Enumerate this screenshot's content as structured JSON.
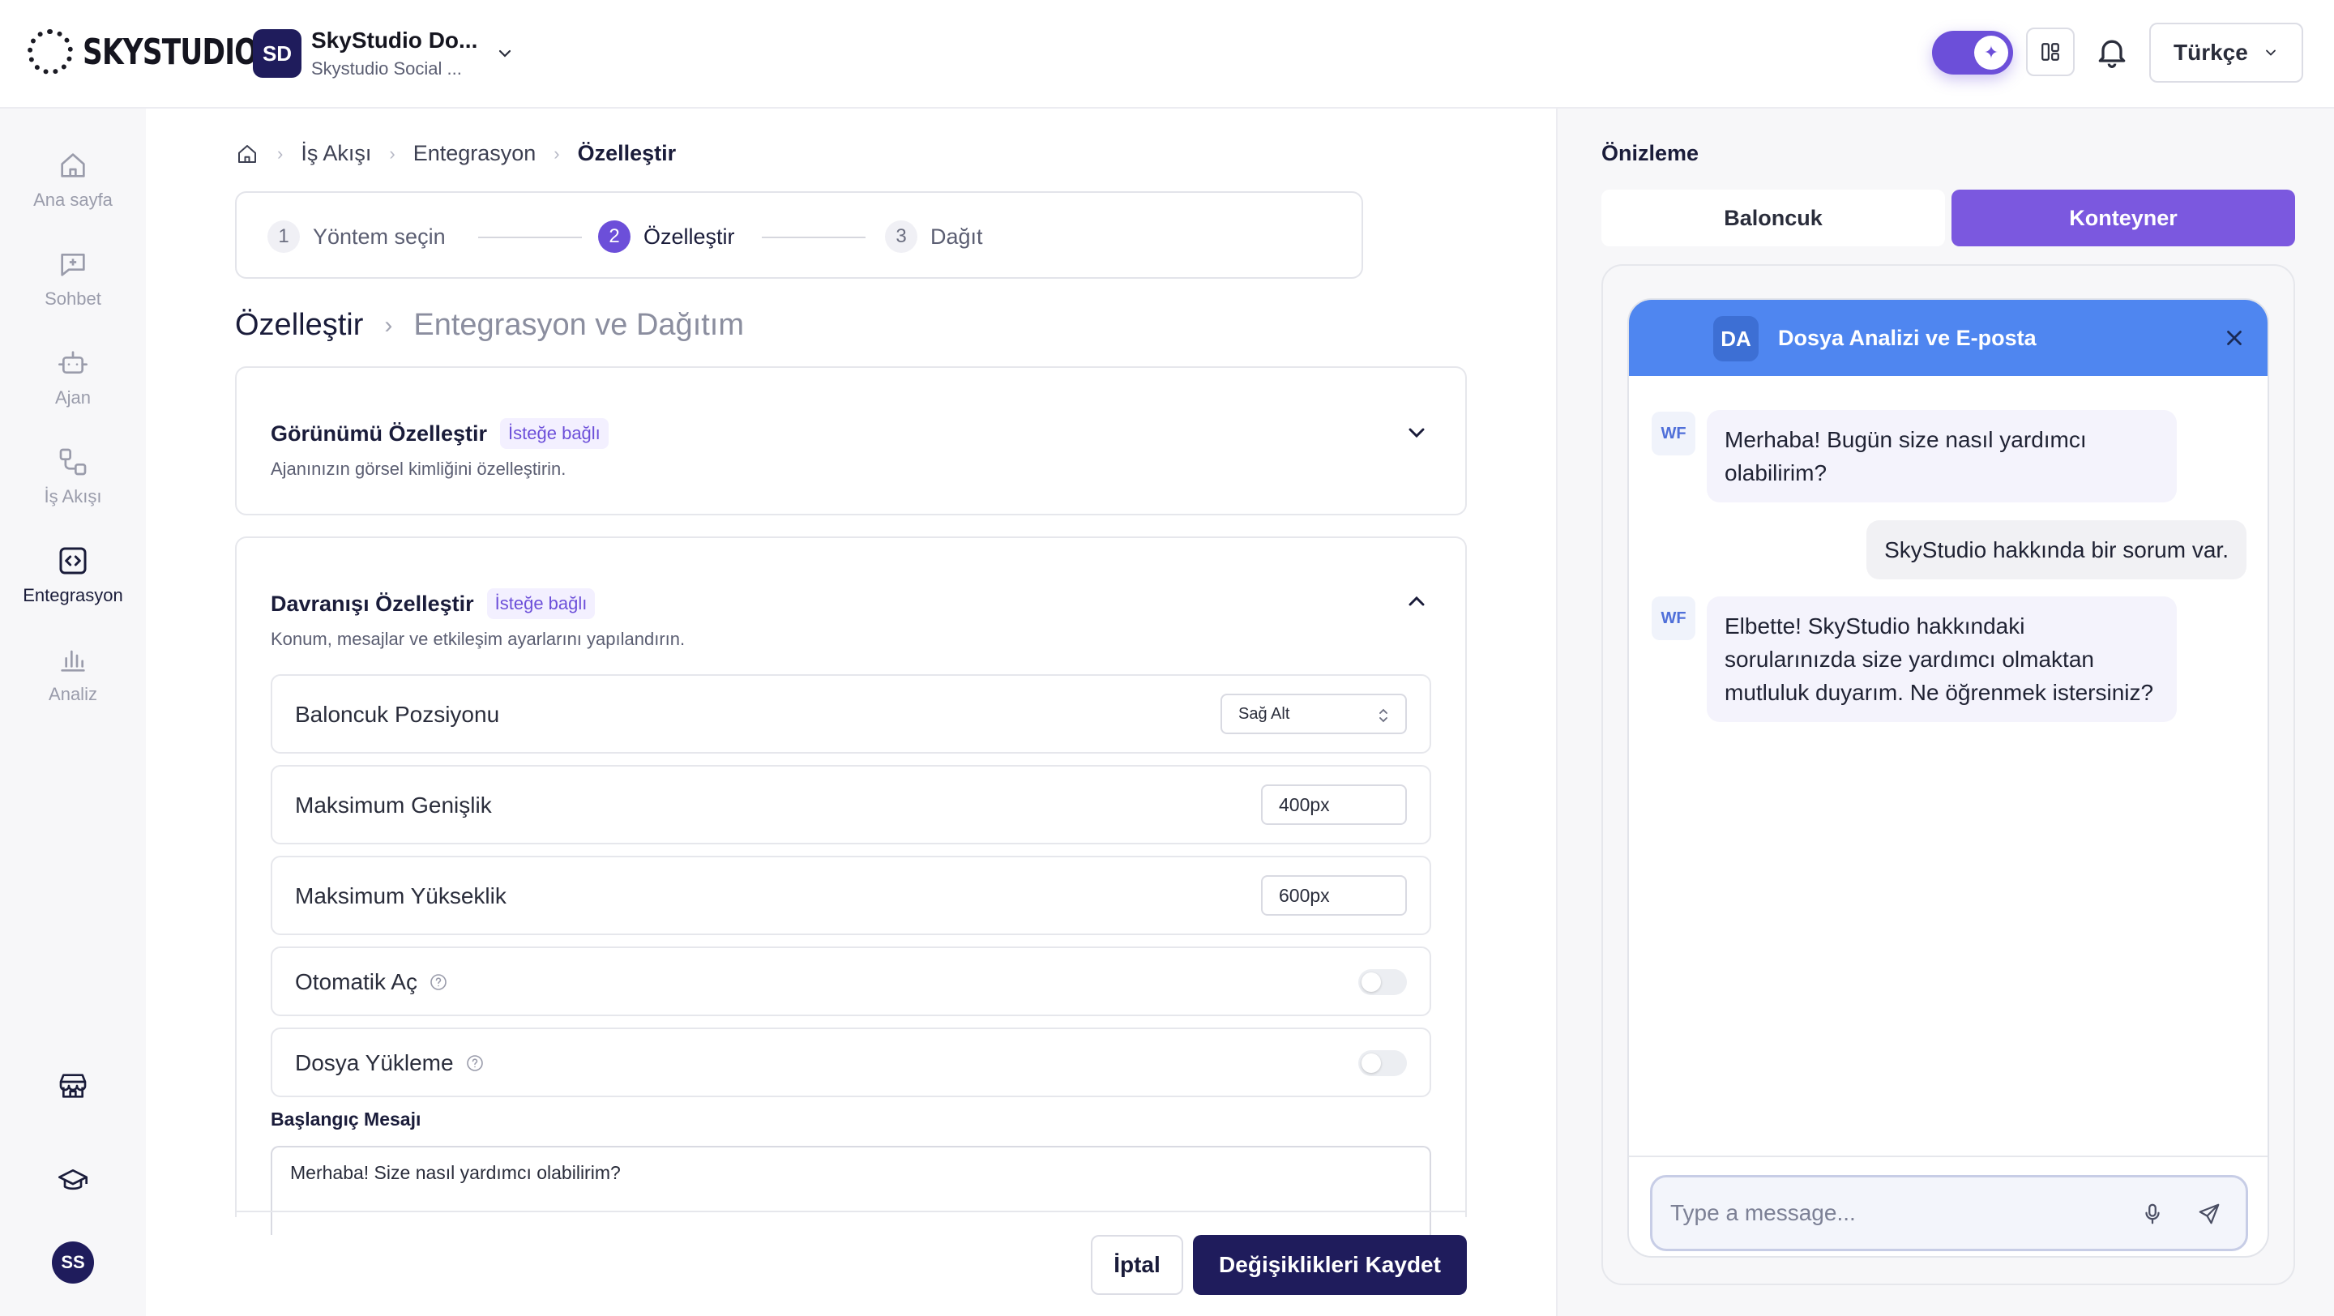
{
  "brand": {
    "logo_text": "SKYSTUDIO"
  },
  "workspace": {
    "initials": "SD",
    "name": "SkyStudio Do...",
    "subtitle": "Skystudio Social ..."
  },
  "header": {
    "language": "Türkçe",
    "icons": [
      "ai-toggle-icon",
      "layout-icon",
      "bell-icon",
      "chevron-down-icon"
    ]
  },
  "sidebar": {
    "items": [
      {
        "label": "Ana sayfa",
        "icon": "home-icon",
        "active": false
      },
      {
        "label": "Sohbet",
        "icon": "chat-plus-icon",
        "active": false
      },
      {
        "label": "Ajan",
        "icon": "robot-icon",
        "active": false
      },
      {
        "label": "İş Akışı",
        "icon": "workflow-icon",
        "active": false
      },
      {
        "label": "Entegrasyon",
        "icon": "code-icon",
        "active": true
      },
      {
        "label": "Analiz",
        "icon": "bar-chart-icon",
        "active": false
      }
    ],
    "bottom_icons": [
      "store-icon",
      "graduation-cap-icon"
    ],
    "user_initials": "SS"
  },
  "breadcrumb": {
    "items": [
      "İş Akışı",
      "Entegrasyon"
    ],
    "current": "Özelleştir"
  },
  "stepper": {
    "steps": [
      {
        "num": "1",
        "label": "Yöntem seçin"
      },
      {
        "num": "2",
        "label": "Özelleştir"
      },
      {
        "num": "3",
        "label": "Dağıt"
      }
    ],
    "active_step": 2
  },
  "page_title": {
    "current": "Özelleştir",
    "next": "Entegrasyon ve Dağıtım"
  },
  "appearance_card": {
    "title": "Görünümü Özelleştir",
    "badge": "İsteğe bağlı",
    "subtitle": "Ajanınızın görsel kimliğini özelleştirin."
  },
  "behavior_card": {
    "title": "Davranışı Özelleştir",
    "badge": "İsteğe bağlı",
    "subtitle": "Konum, mesajlar ve etkileşim ayarlarını yapılandırın.",
    "bubble_position": {
      "label": "Baloncuk Pozsiyonu",
      "value": "Sağ Alt"
    },
    "max_width": {
      "label": "Maksimum Genişlik",
      "value": "400px"
    },
    "max_height": {
      "label": "Maksimum Yükseklik",
      "value": "600px"
    },
    "auto_open": {
      "label": "Otomatik Aç",
      "enabled": false
    },
    "file_upload": {
      "label": "Dosya Yükleme",
      "enabled": false
    },
    "start_message": {
      "label": "Başlangıç Mesajı",
      "value": "Merhaba! Size nasıl yardımcı olabilirim?"
    }
  },
  "actions": {
    "cancel": "İptal",
    "save": "Değişiklikleri Kaydet"
  },
  "preview": {
    "title": "Önizleme",
    "tabs": [
      "Baloncuk",
      "Konteyner"
    ],
    "active_tab": "Konteyner",
    "chat": {
      "initials": "DA",
      "title": "Dosya Analizi ve E-posta",
      "bot_initials": "WF",
      "messages": [
        {
          "role": "bot",
          "text": "Merhaba! Bugün size nasıl yardımcı olabilirim?"
        },
        {
          "role": "user",
          "text": "SkyStudio hakkında bir sorum var."
        },
        {
          "role": "bot",
          "text": "Elbette! SkyStudio hakkındaki sorularınızda size yardımcı olmaktan mutluluk duyarım. Ne öğrenmek istersiniz?"
        }
      ],
      "input_placeholder": "Type a message..."
    }
  },
  "colors": {
    "accent": "#6c4fd9",
    "primary_dark": "#1f1c5c",
    "chat_header": "#4f86f0"
  }
}
